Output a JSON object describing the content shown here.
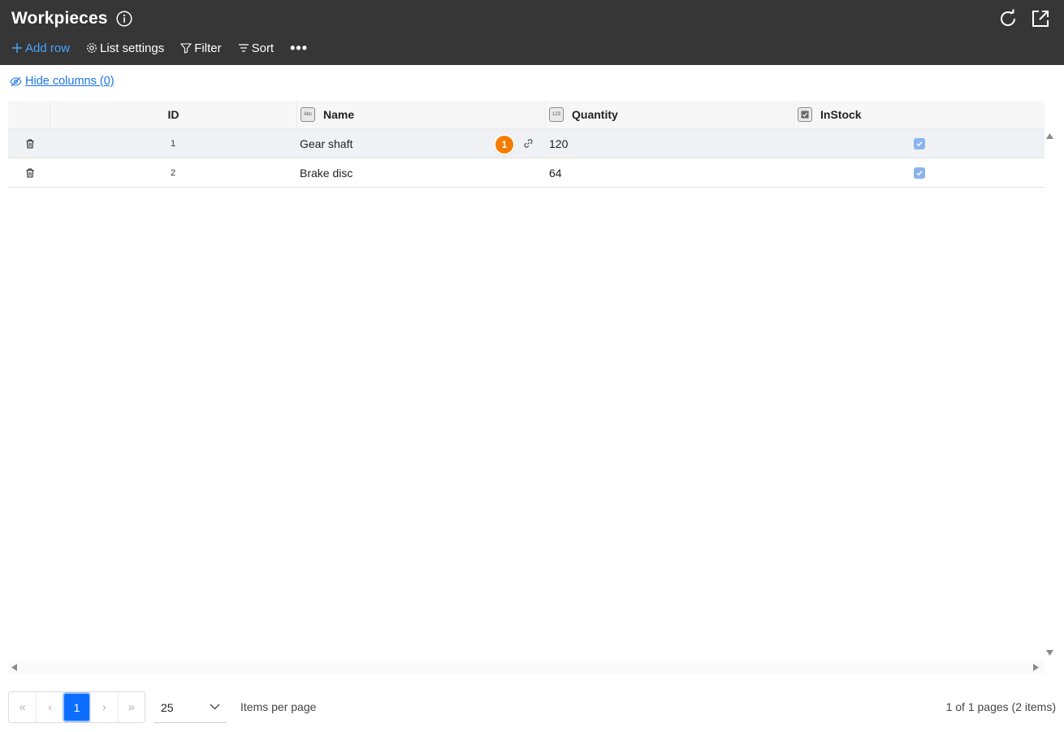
{
  "header": {
    "title": "Workpieces",
    "toolbar": {
      "add_row": "Add row",
      "list_settings": "List settings",
      "filter": "Filter",
      "sort": "Sort",
      "more": "•••"
    }
  },
  "hide_columns": "Hide columns (0)",
  "table": {
    "columns": [
      {
        "label": "ID"
      },
      {
        "label": "Name",
        "type_badge": "Abc"
      },
      {
        "label": "Quantity",
        "type_badge": "123"
      },
      {
        "label": "InStock",
        "type_badge": "checkbox"
      }
    ],
    "rows": [
      {
        "id": "1",
        "name": "Gear shaft",
        "quantity": "120",
        "in_stock": true,
        "badge": "1"
      },
      {
        "id": "2",
        "name": "Brake disc",
        "quantity": "64",
        "in_stock": true
      }
    ]
  },
  "pagination": {
    "first": "«",
    "prev": "‹",
    "current_page": "1",
    "next": "›",
    "last": "»",
    "per_page_value": "25",
    "per_page_label": "Items per page",
    "summary": "1 of 1 pages (2 items)"
  },
  "colors": {
    "header_bg": "#363636",
    "accent": "#4aa3ff",
    "link": "#1a73e8",
    "page_active": "#0d6efd",
    "badge": "#f57c00",
    "checkbox": "#8ab4f0"
  }
}
